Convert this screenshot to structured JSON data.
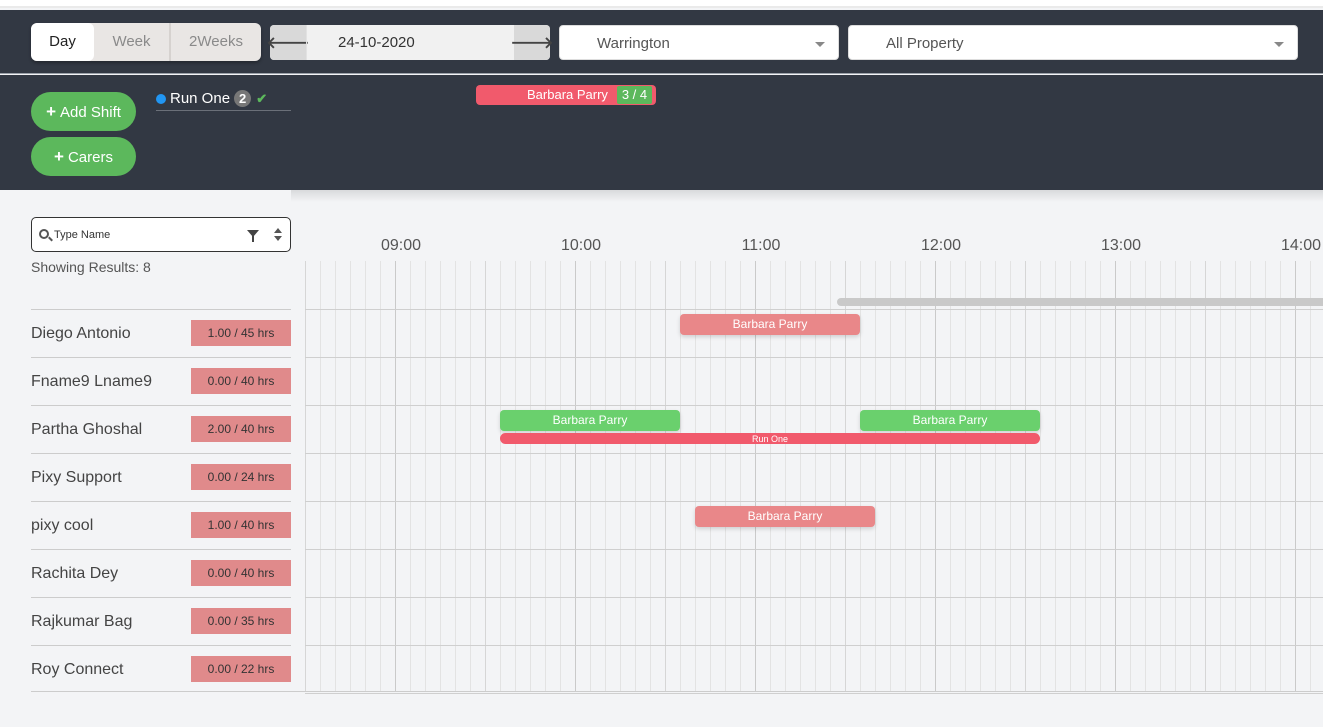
{
  "header": {
    "view_tabs": [
      {
        "label": "Day",
        "active": true
      },
      {
        "label": "Week",
        "active": false
      },
      {
        "label": "2Weeks",
        "active": false
      }
    ],
    "date": "24-10-2020",
    "prev_icon": "arrow-left-icon",
    "next_icon": "arrow-right-icon",
    "location": "Warrington",
    "property": "All Property"
  },
  "panel": {
    "add_shift_label": "Add Shift",
    "carers_label": "Carers",
    "run": {
      "name": "Run One",
      "count": "2",
      "status_icon": "check-icon",
      "dot_color": "#2196f3"
    },
    "pending_shift": {
      "name": "Barbara Parry",
      "count": "3 / 4"
    }
  },
  "search": {
    "placeholder": "Type Name",
    "value": ""
  },
  "results_label": "Showing Results: 8",
  "timeline": {
    "ticks": [
      "09:00",
      "10:00",
      "11:00",
      "12:00",
      "13:00",
      "14:00"
    ],
    "start_hour": 8.5
  },
  "colors": {
    "accent_green": "#5cb85c",
    "shift_red": "#e98789",
    "shift_green": "#6ad06d",
    "run_red": "#f15a6c",
    "header_bg": "#323843"
  },
  "carers": [
    {
      "name": "Diego Antonio",
      "hours": "1.00 / 45 hrs",
      "shifts": [
        {
          "label": "Barbara Parry",
          "start": "10:35",
          "end": "11:35",
          "color": "red"
        }
      ]
    },
    {
      "name": "Fname9 Lname9",
      "hours": "0.00 / 40 hrs",
      "shifts": []
    },
    {
      "name": "Partha Ghoshal",
      "hours": "2.00 / 40 hrs",
      "shifts": [
        {
          "label": "Barbara Parry",
          "start": "09:35",
          "end": "10:35",
          "color": "green"
        },
        {
          "label": "Barbara Parry",
          "start": "11:35",
          "end": "12:35",
          "color": "green"
        }
      ],
      "run": {
        "label": "Run One",
        "start": "09:35",
        "end": "12:35"
      }
    },
    {
      "name": "Pixy Support",
      "hours": "0.00 / 24 hrs",
      "shifts": []
    },
    {
      "name": "pixy cool",
      "hours": "1.00 / 40 hrs",
      "shifts": [
        {
          "label": "Barbara Parry",
          "start": "10:40",
          "end": "11:40",
          "color": "red"
        }
      ]
    },
    {
      "name": "Rachita Dey",
      "hours": "0.00 / 40 hrs",
      "shifts": []
    },
    {
      "name": "Rajkumar Bag",
      "hours": "0.00 / 35 hrs",
      "shifts": []
    },
    {
      "name": "Roy Connect",
      "hours": "0.00 / 22 hrs",
      "shifts": []
    }
  ]
}
